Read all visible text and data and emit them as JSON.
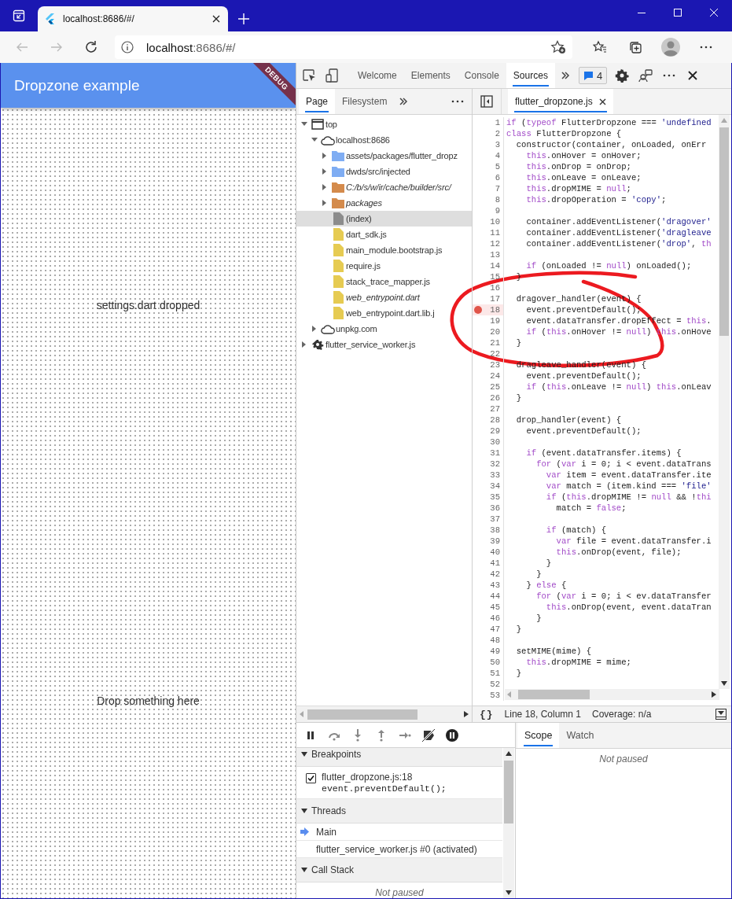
{
  "browser": {
    "tab": {
      "title": "localhost:8686/#/",
      "selected": true
    },
    "address": {
      "host": "localhost",
      "rest": ":8686/#/"
    }
  },
  "app": {
    "title": "Dropzone example",
    "banner": "DEBUG",
    "messages": [
      "settings.dart dropped",
      "Drop something here"
    ]
  },
  "devtools": {
    "tabs": [
      {
        "label": "Welcome",
        "selected": false
      },
      {
        "label": "Elements",
        "selected": false
      },
      {
        "label": "Console",
        "selected": false
      },
      {
        "label": "Sources",
        "selected": true
      }
    ],
    "issues": "4",
    "navigator": {
      "tabs": [
        {
          "label": "Page",
          "selected": true
        },
        {
          "label": "Filesystem",
          "selected": false
        }
      ],
      "tree": [
        {
          "label": "top",
          "kind": "frame",
          "expanded": true,
          "selected": false,
          "children": [
            {
              "label": "localhost:8686",
              "kind": "origin",
              "expanded": true,
              "selected": false,
              "children": [
                {
                  "label": "assets/packages/flutter_dropz",
                  "kind": "folder",
                  "color": "#7fadf3",
                  "expanded": false,
                  "italic": false,
                  "selected": false
                },
                {
                  "label": "dwds/src/injected",
                  "kind": "folder",
                  "color": "#7fadf3",
                  "expanded": false,
                  "italic": false,
                  "selected": false
                },
                {
                  "label": "C:/b/s/w/ir/cache/builder/src/",
                  "kind": "folder",
                  "color": "#d48b4c",
                  "expanded": false,
                  "italic": true,
                  "selected": false
                },
                {
                  "label": "packages",
                  "kind": "folder",
                  "color": "#d48b4c",
                  "expanded": false,
                  "italic": true,
                  "selected": false
                },
                {
                  "label": "(index)",
                  "kind": "file",
                  "color": "#8c8c8c",
                  "italic": false,
                  "selected": true
                },
                {
                  "label": "dart_sdk.js",
                  "kind": "file",
                  "color": "#e6cb52",
                  "italic": false,
                  "selected": false
                },
                {
                  "label": "main_module.bootstrap.js",
                  "kind": "file",
                  "color": "#e6cb52",
                  "italic": false,
                  "selected": false
                },
                {
                  "label": "require.js",
                  "kind": "file",
                  "color": "#e6cb52",
                  "italic": false,
                  "selected": false
                },
                {
                  "label": "stack_trace_mapper.js",
                  "kind": "file",
                  "color": "#e6cb52",
                  "italic": false,
                  "selected": false
                },
                {
                  "label": "web_entrypoint.dart",
                  "kind": "file",
                  "color": "#e6cb52",
                  "italic": true,
                  "selected": false
                },
                {
                  "label": "web_entrypoint.dart.lib.j",
                  "kind": "file",
                  "color": "#e6cb52",
                  "italic": false,
                  "selected": false
                }
              ]
            },
            {
              "label": "unpkg.com",
              "kind": "origin",
              "expanded": false,
              "selected": false
            }
          ]
        },
        {
          "label": "flutter_service_worker.js",
          "kind": "worker",
          "expanded": false,
          "selected": false
        }
      ]
    },
    "editor": {
      "file": {
        "label": "flutter_dropzone.js",
        "selected": true
      },
      "lines": [
        {
          "number": "1",
          "breakpoint": false,
          "segments": [
            {
              "text": "if",
              "kind": "keyword"
            },
            {
              "text": " (",
              "kind": "plain"
            },
            {
              "text": "typeof",
              "kind": "keyword"
            },
            {
              "text": " FlutterDropzone === ",
              "kind": "plain"
            },
            {
              "text": "'undefined",
              "kind": "string"
            }
          ]
        },
        {
          "number": "2",
          "breakpoint": false,
          "segments": [
            {
              "text": "class",
              "kind": "keyword"
            },
            {
              "text": " FlutterDropzone {",
              "kind": "plain"
            }
          ]
        },
        {
          "number": "3",
          "breakpoint": false,
          "segments": [
            {
              "text": "  constructor(container, onLoaded, onErr",
              "kind": "plain"
            }
          ]
        },
        {
          "number": "4",
          "breakpoint": false,
          "segments": [
            {
              "text": "    this",
              "kind": "keyword"
            },
            {
              "text": ".onHover = onHover;",
              "kind": "plain"
            }
          ]
        },
        {
          "number": "5",
          "breakpoint": false,
          "segments": [
            {
              "text": "    this",
              "kind": "keyword"
            },
            {
              "text": ".onDrop = onDrop;",
              "kind": "plain"
            }
          ]
        },
        {
          "number": "6",
          "breakpoint": false,
          "segments": [
            {
              "text": "    this",
              "kind": "keyword"
            },
            {
              "text": ".onLeave = onLeave;",
              "kind": "plain"
            }
          ]
        },
        {
          "number": "7",
          "breakpoint": false,
          "segments": [
            {
              "text": "    this",
              "kind": "keyword"
            },
            {
              "text": ".dropMIME = ",
              "kind": "plain"
            },
            {
              "text": "null",
              "kind": "keyword"
            },
            {
              "text": ";",
              "kind": "plain"
            }
          ]
        },
        {
          "number": "8",
          "breakpoint": false,
          "segments": [
            {
              "text": "    this",
              "kind": "keyword"
            },
            {
              "text": ".dropOperation = ",
              "kind": "plain"
            },
            {
              "text": "'copy'",
              "kind": "string"
            },
            {
              "text": ";",
              "kind": "plain"
            }
          ]
        },
        {
          "number": "9",
          "breakpoint": false
        },
        {
          "number": "10",
          "breakpoint": false,
          "segments": [
            {
              "text": "    container.addEventListener(",
              "kind": "plain"
            },
            {
              "text": "'dragover'",
              "kind": "string"
            }
          ]
        },
        {
          "number": "11",
          "breakpoint": false,
          "segments": [
            {
              "text": "    container.addEventListener(",
              "kind": "plain"
            },
            {
              "text": "'dragleave",
              "kind": "string"
            }
          ]
        },
        {
          "number": "12",
          "breakpoint": false,
          "segments": [
            {
              "text": "    container.addEventListener(",
              "kind": "plain"
            },
            {
              "text": "'drop'",
              "kind": "string"
            },
            {
              "text": ", ",
              "kind": "plain"
            },
            {
              "text": "th",
              "kind": "keyword"
            }
          ]
        },
        {
          "number": "13",
          "breakpoint": false
        },
        {
          "number": "14",
          "breakpoint": false,
          "segments": [
            {
              "text": "    if",
              "kind": "keyword"
            },
            {
              "text": " (onLoaded != ",
              "kind": "plain"
            },
            {
              "text": "null",
              "kind": "keyword"
            },
            {
              "text": ") onLoaded();",
              "kind": "plain"
            }
          ]
        },
        {
          "number": "15",
          "breakpoint": false,
          "segments": [
            {
              "text": "  }",
              "kind": "plain"
            }
          ]
        },
        {
          "number": "16",
          "breakpoint": false
        },
        {
          "number": "17",
          "breakpoint": false,
          "segments": [
            {
              "text": "  dragover_handler(event) {",
              "kind": "plain"
            }
          ]
        },
        {
          "number": "18",
          "breakpoint": true,
          "segments": [
            {
              "text": "    event.preventDefault();",
              "kind": "plain"
            }
          ]
        },
        {
          "number": "19",
          "breakpoint": false,
          "segments": [
            {
              "text": "    event.dataTransfer.dropEffect = ",
              "kind": "plain"
            },
            {
              "text": "this",
              "kind": "keyword"
            },
            {
              "text": ".",
              "kind": "plain"
            }
          ]
        },
        {
          "number": "20",
          "breakpoint": false,
          "segments": [
            {
              "text": "    if",
              "kind": "keyword"
            },
            {
              "text": " (",
              "kind": "plain"
            },
            {
              "text": "this",
              "kind": "keyword"
            },
            {
              "text": ".onHover != ",
              "kind": "plain"
            },
            {
              "text": "null",
              "kind": "keyword"
            },
            {
              "text": ") ",
              "kind": "plain"
            },
            {
              "text": "this",
              "kind": "keyword"
            },
            {
              "text": ".onHove",
              "kind": "plain"
            }
          ]
        },
        {
          "number": "21",
          "breakpoint": false,
          "segments": [
            {
              "text": "  }",
              "kind": "plain"
            }
          ]
        },
        {
          "number": "22",
          "breakpoint": false
        },
        {
          "number": "23",
          "breakpoint": false,
          "segments": [
            {
              "text": "  dragleave_handler(event) {",
              "kind": "plain"
            }
          ]
        },
        {
          "number": "24",
          "breakpoint": false,
          "segments": [
            {
              "text": "    event.preventDefault();",
              "kind": "plain"
            }
          ]
        },
        {
          "number": "25",
          "breakpoint": false,
          "segments": [
            {
              "text": "    if",
              "kind": "keyword"
            },
            {
              "text": " (",
              "kind": "plain"
            },
            {
              "text": "this",
              "kind": "keyword"
            },
            {
              "text": ".onLeave != ",
              "kind": "plain"
            },
            {
              "text": "null",
              "kind": "keyword"
            },
            {
              "text": ") ",
              "kind": "plain"
            },
            {
              "text": "this",
              "kind": "keyword"
            },
            {
              "text": ".onLeav",
              "kind": "plain"
            }
          ]
        },
        {
          "number": "26",
          "breakpoint": false,
          "segments": [
            {
              "text": "  }",
              "kind": "plain"
            }
          ]
        },
        {
          "number": "27",
          "breakpoint": false
        },
        {
          "number": "28",
          "breakpoint": false,
          "segments": [
            {
              "text": "  drop_handler(event) {",
              "kind": "plain"
            }
          ]
        },
        {
          "number": "29",
          "breakpoint": false,
          "segments": [
            {
              "text": "    event.preventDefault();",
              "kind": "plain"
            }
          ]
        },
        {
          "number": "30",
          "breakpoint": false
        },
        {
          "number": "31",
          "breakpoint": false,
          "segments": [
            {
              "text": "    if",
              "kind": "keyword"
            },
            {
              "text": " (event.dataTransfer.items) {",
              "kind": "plain"
            }
          ]
        },
        {
          "number": "32",
          "breakpoint": false,
          "segments": [
            {
              "text": "      for",
              "kind": "keyword"
            },
            {
              "text": " (",
              "kind": "plain"
            },
            {
              "text": "var",
              "kind": "keyword"
            },
            {
              "text": " i = 0; i < event.dataTrans",
              "kind": "plain"
            }
          ]
        },
        {
          "number": "33",
          "breakpoint": false,
          "segments": [
            {
              "text": "        var",
              "kind": "keyword"
            },
            {
              "text": " item = event.dataTransfer.ite",
              "kind": "plain"
            }
          ]
        },
        {
          "number": "34",
          "breakpoint": false,
          "segments": [
            {
              "text": "        var",
              "kind": "keyword"
            },
            {
              "text": " match = (item.kind === ",
              "kind": "plain"
            },
            {
              "text": "'file'",
              "kind": "string"
            }
          ]
        },
        {
          "number": "35",
          "breakpoint": false,
          "segments": [
            {
              "text": "        if",
              "kind": "keyword"
            },
            {
              "text": " (",
              "kind": "plain"
            },
            {
              "text": "this",
              "kind": "keyword"
            },
            {
              "text": ".dropMIME != ",
              "kind": "plain"
            },
            {
              "text": "null",
              "kind": "keyword"
            },
            {
              "text": " && !",
              "kind": "plain"
            },
            {
              "text": "thi",
              "kind": "keyword"
            }
          ]
        },
        {
          "number": "36",
          "breakpoint": false,
          "segments": [
            {
              "text": "          match = ",
              "kind": "plain"
            },
            {
              "text": "false",
              "kind": "keyword"
            },
            {
              "text": ";",
              "kind": "plain"
            }
          ]
        },
        {
          "number": "37",
          "breakpoint": false
        },
        {
          "number": "38",
          "breakpoint": false,
          "segments": [
            {
              "text": "        if",
              "kind": "keyword"
            },
            {
              "text": " (match) {",
              "kind": "plain"
            }
          ]
        },
        {
          "number": "39",
          "breakpoint": false,
          "segments": [
            {
              "text": "          var",
              "kind": "keyword"
            },
            {
              "text": " file = event.dataTransfer.i",
              "kind": "plain"
            }
          ]
        },
        {
          "number": "40",
          "breakpoint": false,
          "segments": [
            {
              "text": "          this",
              "kind": "keyword"
            },
            {
              "text": ".onDrop(event, file);",
              "kind": "plain"
            }
          ]
        },
        {
          "number": "41",
          "breakpoint": false,
          "segments": [
            {
              "text": "        }",
              "kind": "plain"
            }
          ]
        },
        {
          "number": "42",
          "breakpoint": false,
          "segments": [
            {
              "text": "      }",
              "kind": "plain"
            }
          ]
        },
        {
          "number": "43",
          "breakpoint": false,
          "segments": [
            {
              "text": "    } ",
              "kind": "plain"
            },
            {
              "text": "else",
              "kind": "keyword"
            },
            {
              "text": " {",
              "kind": "plain"
            }
          ]
        },
        {
          "number": "44",
          "breakpoint": false,
          "segments": [
            {
              "text": "      for",
              "kind": "keyword"
            },
            {
              "text": " (",
              "kind": "plain"
            },
            {
              "text": "var",
              "kind": "keyword"
            },
            {
              "text": " i = 0; i < ev.dataTransfer",
              "kind": "plain"
            }
          ]
        },
        {
          "number": "45",
          "breakpoint": false,
          "segments": [
            {
              "text": "        this",
              "kind": "keyword"
            },
            {
              "text": ".onDrop(event, event.dataTran",
              "kind": "plain"
            }
          ]
        },
        {
          "number": "46",
          "breakpoint": false,
          "segments": [
            {
              "text": "      }",
              "kind": "plain"
            }
          ]
        },
        {
          "number": "47",
          "breakpoint": false,
          "segments": [
            {
              "text": "  }",
              "kind": "plain"
            }
          ]
        },
        {
          "number": "48",
          "breakpoint": false
        },
        {
          "number": "49",
          "breakpoint": false,
          "segments": [
            {
              "text": "  setMIME(mime) {",
              "kind": "plain"
            }
          ]
        },
        {
          "number": "50",
          "breakpoint": false,
          "segments": [
            {
              "text": "    this",
              "kind": "keyword"
            },
            {
              "text": ".dropMIME = mime;",
              "kind": "plain"
            }
          ]
        },
        {
          "number": "51",
          "breakpoint": false,
          "segments": [
            {
              "text": "  }",
              "kind": "plain"
            }
          ]
        },
        {
          "number": "52",
          "breakpoint": false
        },
        {
          "number": "53",
          "breakpoint": false
        }
      ],
      "status": {
        "format": "{}",
        "position": "Line 18, Column 1",
        "coverage": "Coverage: n/a"
      }
    },
    "debugger": {
      "sections": [
        {
          "title": "Breakpoints",
          "kind": "breakpoints",
          "expanded": true,
          "items": [
            {
              "location": "flutter_dropzone.js:18",
              "code": "event.preventDefault();",
              "checked": true
            }
          ]
        },
        {
          "title": "Threads",
          "kind": "threads",
          "expanded": true,
          "items": [
            {
              "label": "Main",
              "current": true
            },
            {
              "label": "flutter_service_worker.js #0 (activated)",
              "current": false
            }
          ]
        },
        {
          "title": "Call Stack",
          "kind": "message",
          "expanded": true,
          "message": "Not paused"
        }
      ]
    },
    "sidebar": {
      "tabs": [
        {
          "label": "Scope",
          "selected": true
        },
        {
          "label": "Watch",
          "selected": false
        }
      ],
      "message": "Not paused"
    }
  }
}
